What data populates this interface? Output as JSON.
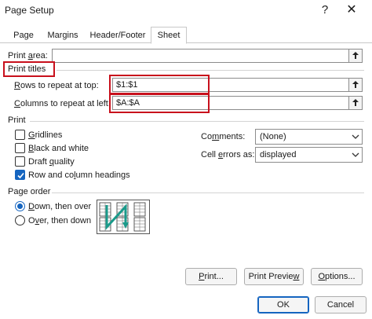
{
  "window": {
    "title": "Page Setup",
    "help_glyph": "?",
    "close_glyph": "✕"
  },
  "tabs": [
    {
      "label": "Page",
      "active": false
    },
    {
      "label": "Margins",
      "active": false
    },
    {
      "label": "Header/Footer",
      "active": false
    },
    {
      "label": "Sheet",
      "active": true
    }
  ],
  "print_area": {
    "label_pre": "Print ",
    "label_key": "a",
    "label_post": "rea:",
    "value": ""
  },
  "print_titles": {
    "heading": "Print titles",
    "rows_label_key": "R",
    "rows_label_post": "ows to repeat at top:",
    "rows_value": "$1:$1",
    "cols_label_key": "C",
    "cols_label_post": "olumns to repeat at left:",
    "cols_value": "$A:$A"
  },
  "print": {
    "heading": "Print",
    "gridlines_key": "G",
    "gridlines_post": "ridlines",
    "gridlines": false,
    "bw_key": "B",
    "bw_post": "lack and white",
    "bw": false,
    "draft_pre": "Draft ",
    "draft_key": "q",
    "draft_post": "uality",
    "draft": false,
    "headings_pre": "Row and co",
    "headings_key": "l",
    "headings_post": "umn headings",
    "headings": true,
    "comments_pre": "Co",
    "comments_key": "m",
    "comments_post": "ments:",
    "comments_value": "(None)",
    "errors_pre": "Cell ",
    "errors_key": "e",
    "errors_post": "rrors as:",
    "errors_value": "displayed"
  },
  "page_order": {
    "heading": "Page order",
    "down_key": "D",
    "down_post": "own, then over",
    "down_selected": true,
    "over_pre": "O",
    "over_key": "v",
    "over_post": "er, then down",
    "over_selected": false
  },
  "buttons": {
    "print_key": "P",
    "print_post": "rint...",
    "preview_pre": "Print Previe",
    "preview_key": "w",
    "options_key": "O",
    "options_post": "ptions...",
    "ok": "OK",
    "cancel": "Cancel"
  },
  "colors": {
    "highlight": "#c8101c",
    "accent": "#1565c0",
    "arrow": "#1a9a8a"
  }
}
